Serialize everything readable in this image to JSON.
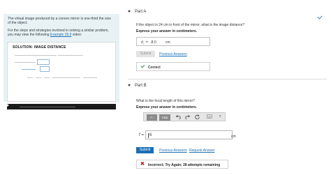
{
  "left_panel": {
    "intro": "The virtual image produced by a convex mirror is one-third the size of the object.",
    "strategy_prefix": "For the steps and strategies involved in solving a similar problem, you may view the following ",
    "strategy_link": "Example 26.9",
    "strategy_suffix": " video:",
    "video_title": "SOLUTION: IMAGE DISTANCE"
  },
  "part_a": {
    "header": "Part A",
    "question": "If the object is 24 cm in front of the mirror, what is the image distance?",
    "instruction": "Express your answer in centimeters.",
    "answer_var": "d",
    "answer_sub": "i",
    "answer_eq": "=",
    "answer_value": "-8.0",
    "answer_unit": "cm",
    "submit_label": "Submit",
    "previous_answers_label": "Previous Answers",
    "result_label": "Correct"
  },
  "part_b": {
    "header": "Part B",
    "question": "What is the focal length of this mirror?",
    "instruction": "Express your answer in centimeters.",
    "toolbar": {
      "frac_label": "√̄ □",
      "greek_label": "AΣφ",
      "help_label": "?"
    },
    "input_label": "f =",
    "input_value": "6",
    "unit": "cm",
    "submit_label": "Submit",
    "previous_answers_label": "Previous Answers",
    "request_answer_label": "Request Answer",
    "result_label": "Incorrect; Try Again; 28 attempts remaining"
  },
  "colors": {
    "link": "#1a6fb4",
    "submit_bg": "#1a6fb4",
    "correct_check": "#2e8b3a",
    "incorrect_x": "#c62828",
    "panel_bg": "#e8f2f4"
  },
  "icons": [
    "check-icon",
    "collapse-triangle-icon",
    "undo-icon",
    "redo-icon",
    "reset-icon",
    "keyboard-icon",
    "help-icon",
    "close-x-icon",
    "play-icon"
  ]
}
